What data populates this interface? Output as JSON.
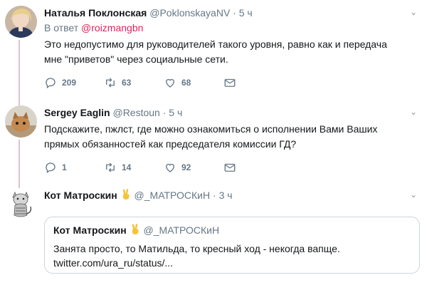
{
  "tweets": [
    {
      "name": "Наталья Поклонская",
      "handle": "@PoklonskayaNV",
      "time": "5 ч",
      "reply_prefix": "В ответ",
      "reply_handle": "@roizmangbn",
      "text_line1": "Это недопустимо для руководителей такого уровня, равно как и передача",
      "text_line2": "мне \"приветов\" через социальные сети.",
      "replies": "209",
      "retweets": "63",
      "likes": "68"
    },
    {
      "name": "Sergey Eaglin",
      "handle": "@Restoun",
      "time": "5 ч",
      "text_line1": "Подскажите, пжлст, где можно ознакомиться о исполнении Вами Ваших",
      "text_line2": "прямых обязанностей как председателя комиссии ГД?",
      "replies": "1",
      "retweets": "14",
      "likes": "92"
    },
    {
      "name": "Кот Матроскин",
      "handle": "@_МАТРОСКиН",
      "time": "3 ч",
      "quote": {
        "name": "Кот Матроскин",
        "handle": "@_МАТРОСКиН",
        "text_line1": "Занята просто, то Матильда, то кресный ход - некогда вапще.",
        "text_line2": "twitter.com/ura_ru/status/..."
      }
    }
  ],
  "dot": "·",
  "caret": "⌄",
  "icons": [
    "reply-icon",
    "retweet-icon",
    "like-icon",
    "message-icon",
    "victory-hand-emoji"
  ],
  "colors": {
    "accent": "#e0245e",
    "muted": "#657786",
    "thread": "#e0c1cf"
  }
}
